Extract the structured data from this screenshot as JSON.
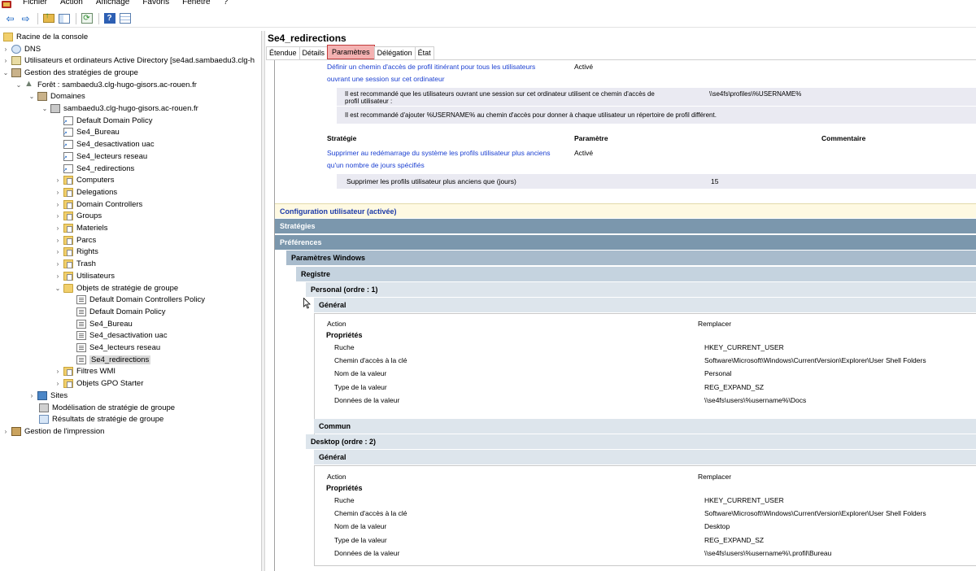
{
  "menubar": {
    "items": [
      "Fichier",
      "Action",
      "Affichage",
      "Favoris",
      "Fenêtre",
      "?"
    ]
  },
  "toolbar": {
    "buttons": [
      "back-arrow-icon",
      "forward-arrow-icon",
      "folder-up-icon",
      "console-tree-icon",
      "refresh-icon",
      "help-icon",
      "panel-icon"
    ]
  },
  "tree": {
    "root": "Racine de la console",
    "dns": "DNS",
    "aduc": "Utilisateurs et ordinateurs Active Directory [se4ad.sambaedu3.clg-h",
    "gpm": "Gestion des stratégies de groupe",
    "forest": "Forêt : sambaedu3.clg-hugo-gisors.ac-rouen.fr",
    "domains": "Domaines",
    "domain": "sambaedu3.clg-hugo-gisors.ac-rouen.fr",
    "links": [
      "Default Domain Policy",
      "Se4_Bureau",
      "Se4_desactivation uac",
      "Se4_lecteurs reseau",
      "Se4_redirections"
    ],
    "ous": [
      "Computers",
      "Delegations",
      "Domain Controllers",
      "Groups",
      "Materiels",
      "Parcs",
      "Rights",
      "Trash",
      "Utilisateurs"
    ],
    "gpo_folder": "Objets de stratégie de groupe",
    "gpos": [
      "Default Domain Controllers Policy",
      "Default Domain Policy",
      "Se4_Bureau",
      "Se4_desactivation uac",
      "Se4_lecteurs reseau",
      "Se4_redirections"
    ],
    "wmi": "Filtres WMI",
    "starter": "Objets GPO Starter",
    "sites": "Sites",
    "modeling": "Modélisation de stratégie de groupe",
    "results": "Résultats de stratégie de groupe",
    "print": "Gestion de l'impression"
  },
  "right": {
    "title": "Se4_redirections",
    "tabs": [
      "Étendue",
      "Détails",
      "Paramètres",
      "Délégation",
      "État"
    ],
    "active_tab": "Paramètres"
  },
  "report": {
    "policy1": {
      "name_line1": "Définir un chemin d'accès de profil itinérant pour tous les utilisateurs",
      "name_line2": "ouvrant une session sur cet ordinateur",
      "state": "Activé",
      "note1_line1": "Il est recommandé que les utilisateurs ouvrant une session sur cet ordinateur utilisent ce chemin d'accès de",
      "note1_line2": "profil utilisateur :",
      "note1_value": "\\\\se4fs\\profiles\\%USERNAME%",
      "note2": "Il est recommandé d'ajouter %USERNAME% au chemin d'accès pour donner à chaque utilisateur un répertoire de profil différent."
    },
    "headers": {
      "strategy": "Stratégie",
      "parameter": "Paramètre",
      "comment": "Commentaire"
    },
    "policy2": {
      "name_line1": "Supprimer au redémarrage du système les profils utilisateur plus anciens",
      "name_line2": "qu'un nombre de jours spécifiés",
      "state": "Activé",
      "detail_label": "Supprimer les profils utilisateur plus anciens que (jours)",
      "detail_value": "15"
    },
    "user_config": "Configuration utilisateur (activée)",
    "strategies": "Stratégies",
    "preferences": "Préférences",
    "windows_params": "Paramètres Windows",
    "registry": "Registre",
    "general": "Général",
    "common": "Commun",
    "action_label": "Action",
    "action_value": "Remplacer",
    "properties": "Propriétés",
    "labels": {
      "hive": "Ruche",
      "key_path": "Chemin d'accès à la clé",
      "value_name": "Nom de la valeur",
      "value_type": "Type de la valeur",
      "value_data": "Données de la valeur"
    },
    "personal": {
      "header": "Personal (ordre : 1)",
      "hive": "HKEY_CURRENT_USER",
      "key_path": "Software\\Microsoft\\Windows\\CurrentVersion\\Explorer\\User Shell Folders",
      "value_name": "Personal",
      "value_type": "REG_EXPAND_SZ",
      "value_data": "\\\\se4fs\\users\\%username%\\Docs"
    },
    "desktop": {
      "header": "Desktop (ordre : 2)",
      "hive": "HKEY_CURRENT_USER",
      "key_path": "Software\\Microsoft\\Windows\\CurrentVersion\\Explorer\\User Shell Folders",
      "value_name": "Desktop",
      "value_type": "REG_EXPAND_SZ",
      "value_data": "\\\\se4fs\\users\\%username%\\.profil\\Bureau"
    }
  }
}
